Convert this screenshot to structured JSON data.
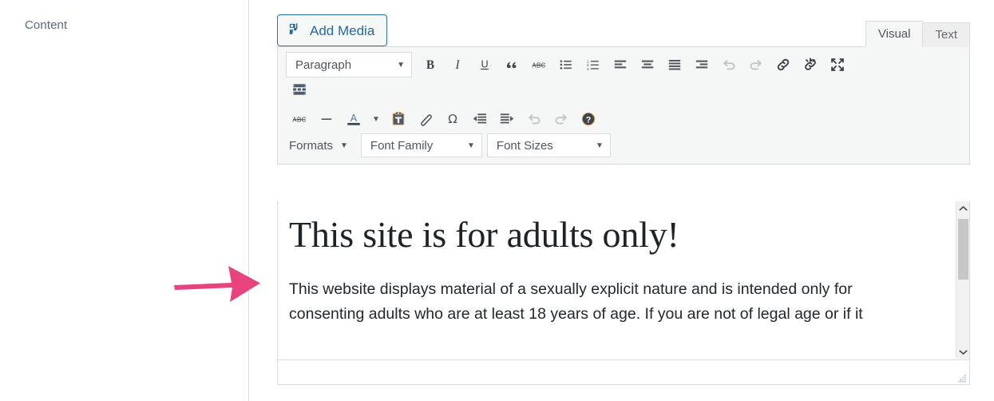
{
  "field": {
    "label": "Content"
  },
  "annotation": {
    "arrow_icon": "arrow-right-icon",
    "color": "#e8437f"
  },
  "editor": {
    "media_buttons": [
      {
        "id": "add-media",
        "label": "Add Media",
        "icon": "add-media-icon"
      }
    ],
    "tabs": [
      {
        "id": "visual",
        "label": "Visual",
        "active": true
      },
      {
        "id": "text",
        "label": "Text",
        "active": false
      }
    ],
    "toolbar_rows": [
      {
        "id": "row-1",
        "items": [
          {
            "type": "select",
            "id": "paragraph",
            "label": "Paragraph",
            "icon": "chevron-down-icon"
          },
          {
            "type": "button",
            "id": "bold",
            "label": "Bold",
            "icon": "bold-icon"
          },
          {
            "type": "button",
            "id": "italic",
            "label": "Italic",
            "icon": "italic-icon"
          },
          {
            "type": "button",
            "id": "underline",
            "label": "Underline",
            "icon": "underline-icon"
          },
          {
            "type": "button",
            "id": "blockquote",
            "label": "Blockquote",
            "icon": "blockquote-icon"
          },
          {
            "type": "button",
            "id": "strikethrough",
            "label": "Strikethrough",
            "icon": "strikethrough-icon"
          },
          {
            "type": "button",
            "id": "bullist",
            "label": "Bulleted list",
            "icon": "bullet-list-icon"
          },
          {
            "type": "button",
            "id": "numlist",
            "label": "Numbered list",
            "icon": "numbered-list-icon"
          },
          {
            "type": "button",
            "id": "alignleft",
            "label": "Align left",
            "icon": "align-left-icon"
          },
          {
            "type": "button",
            "id": "aligncenter",
            "label": "Align center",
            "icon": "align-center-icon"
          },
          {
            "type": "button",
            "id": "alignjustify",
            "label": "Justify",
            "icon": "align-justify-icon"
          },
          {
            "type": "button",
            "id": "alignright",
            "label": "Align right",
            "icon": "align-right-icon"
          },
          {
            "type": "button",
            "id": "undo",
            "label": "Undo",
            "icon": "undo-icon",
            "disabled": true
          },
          {
            "type": "button",
            "id": "redo",
            "label": "Redo",
            "icon": "redo-icon",
            "disabled": true
          },
          {
            "type": "button",
            "id": "link",
            "label": "Insert/edit link",
            "icon": "link-icon"
          },
          {
            "type": "button",
            "id": "unlink",
            "label": "Remove link",
            "icon": "unlink-icon"
          },
          {
            "type": "button",
            "id": "fullscreen",
            "label": "Fullscreen",
            "icon": "fullscreen-icon"
          }
        ]
      },
      {
        "id": "row-2",
        "items": [
          {
            "type": "button",
            "id": "toolbar-toggle",
            "label": "Toolbar Toggle",
            "icon": "toolbar-toggle-icon"
          }
        ]
      },
      {
        "id": "row-3",
        "items": [
          {
            "type": "button",
            "id": "strikethrough-2",
            "label": "Strikethrough",
            "icon": "strikethrough-icon"
          },
          {
            "type": "button",
            "id": "hr",
            "label": "Horizontal line",
            "icon": "horizontal-rule-icon"
          },
          {
            "type": "button",
            "id": "forecolor",
            "label": "Text color",
            "icon": "text-color-icon"
          },
          {
            "type": "button",
            "id": "forecolor-caret",
            "label": "Text color options",
            "icon": "chevron-down-icon"
          },
          {
            "type": "button",
            "id": "pastetext",
            "label": "Paste as text",
            "icon": "paste-as-text-icon"
          },
          {
            "type": "button",
            "id": "removeformat",
            "label": "Clear formatting",
            "icon": "eraser-icon"
          },
          {
            "type": "button",
            "id": "charmap",
            "label": "Special character",
            "icon": "omega-icon"
          },
          {
            "type": "button",
            "id": "outdent",
            "label": "Decrease indent",
            "icon": "outdent-icon"
          },
          {
            "type": "button",
            "id": "indent",
            "label": "Increase indent",
            "icon": "indent-icon"
          },
          {
            "type": "button",
            "id": "undo-2",
            "label": "Undo",
            "icon": "undo-icon",
            "disabled": true
          },
          {
            "type": "button",
            "id": "redo-2",
            "label": "Redo",
            "icon": "redo-icon",
            "disabled": true
          },
          {
            "type": "button",
            "id": "help",
            "label": "Keyboard Shortcuts",
            "icon": "help-icon"
          }
        ]
      },
      {
        "id": "row-4",
        "items": [
          {
            "type": "plain",
            "id": "formats",
            "label": "Formats",
            "icon": "chevron-down-icon"
          },
          {
            "type": "select",
            "id": "fontfamily",
            "label": "Font Family",
            "icon": "chevron-down-icon"
          },
          {
            "type": "select",
            "id": "fontsizes",
            "label": "Font Sizes",
            "icon": "chevron-down-icon"
          }
        ]
      }
    ],
    "content": {
      "heading": "This site is for adults only!",
      "paragraph": "This website displays material of a sexually explicit nature and is intended only for consenting adults who are at least 18 years of age. If you are not of legal age or if it"
    },
    "scrollbar": {
      "up_icon": "chevron-up-icon",
      "down_icon": "chevron-down-icon"
    },
    "status_bar": {
      "path": "",
      "resize_icon": "resize-grip-icon"
    }
  },
  "colors": {
    "accent": "#246ba4",
    "annotation": "#e8437f",
    "toolbar_bg": "#f5f6f6",
    "border": "#dcdcde",
    "icon": "#50575e",
    "icon_disabled": "#c3c4c7"
  }
}
